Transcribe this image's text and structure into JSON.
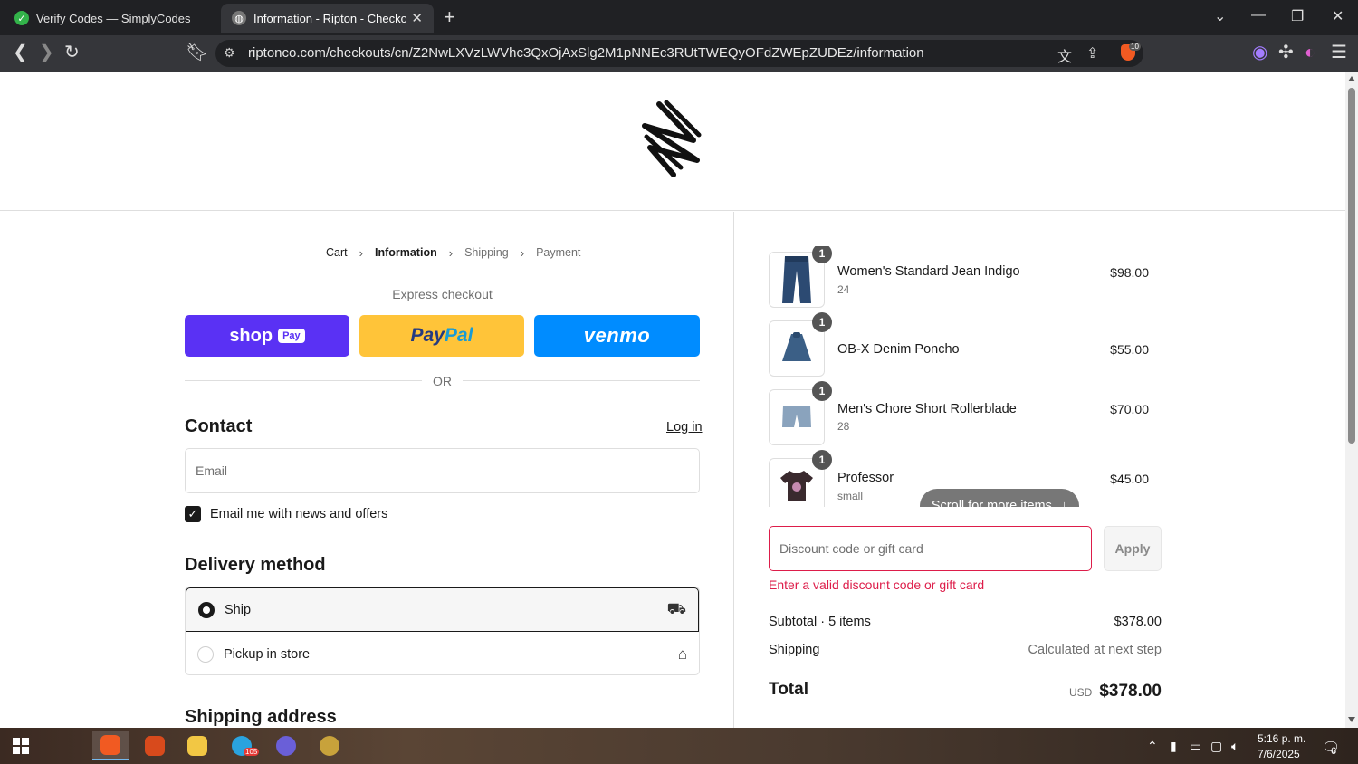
{
  "browser": {
    "tabs": [
      {
        "title": "Verify Codes — SimplyCodes",
        "icon": "simplycodes-icon"
      },
      {
        "title": "Information - Ripton - Checkout",
        "icon": "globe-icon"
      }
    ],
    "url": "riptonco.com/checkouts/cn/Z2NwLXVzLWVhc3QxOjAxSlg2M1pNNEc3RUtTWEQyOFdZWEpZUDEz/information",
    "brave_badge": "10"
  },
  "breadcrumb": {
    "cart": "Cart",
    "information": "Information",
    "shipping": "Shipping",
    "payment": "Payment"
  },
  "express": {
    "label": "Express checkout",
    "shop_label": "shop",
    "shop_pill": "Pay",
    "paypal_a": "Pay",
    "paypal_b": "Pal",
    "venmo": "venmo",
    "or": "OR"
  },
  "contact": {
    "heading": "Contact",
    "login": "Log in",
    "email_placeholder": "Email",
    "newsletter": "Email me with news and offers"
  },
  "delivery": {
    "heading": "Delivery method",
    "ship": "Ship",
    "pickup": "Pickup in store"
  },
  "shipping_address": {
    "heading": "Shipping address"
  },
  "summary": {
    "items": [
      {
        "qty": "1",
        "name": "Women's Standard Jean Indigo",
        "variant": "24",
        "price": "$98.00"
      },
      {
        "qty": "1",
        "name": "OB-X Denim Poncho",
        "variant": "",
        "price": "$55.00"
      },
      {
        "qty": "1",
        "name": "Men's Chore Short Rollerblade",
        "variant": "28",
        "price": "$70.00"
      },
      {
        "qty": "1",
        "name": "Professor",
        "variant": "small",
        "price": "$45.00"
      }
    ],
    "scroll_hint": "Scroll for more items",
    "discount_placeholder": "Discount code or gift card",
    "apply": "Apply",
    "error": "Enter a valid discount code or gift card",
    "subtotal_label": "Subtotal · 5 items",
    "subtotal_value": "$378.00",
    "shipping_label": "Shipping",
    "shipping_value": "Calculated at next step",
    "total_label": "Total",
    "currency": "USD",
    "total_value": "$378.00"
  },
  "taskbar": {
    "time": "5:16 p. m.",
    "date": "7/6/2025",
    "notifications": "6",
    "telegram_badge": "105"
  },
  "colors": {
    "shop_pay": "#5a31f4",
    "paypal": "#ffc439",
    "venmo": "#008cff",
    "error": "#dd1d4a"
  }
}
